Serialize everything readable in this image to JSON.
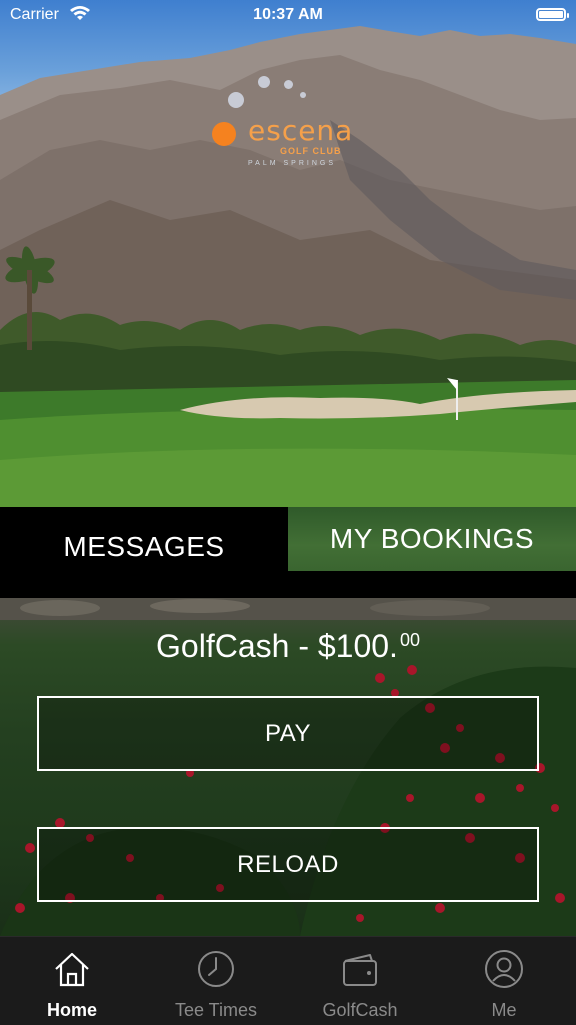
{
  "status_bar": {
    "carrier": "Carrier",
    "time": "10:37 AM"
  },
  "logo": {
    "brand": "escena",
    "sub": "GOLF CLUB",
    "tagline": "PALM SPRINGS"
  },
  "tabs": [
    {
      "label": "MESSAGES"
    },
    {
      "label": "MY BOOKINGS"
    }
  ],
  "golfcash": {
    "prefix": "GolfCash - $100.",
    "cents": "00"
  },
  "buttons": {
    "pay": "PAY",
    "reload": "RELOAD"
  },
  "nav": [
    {
      "label": "Home",
      "icon": "home-icon",
      "active": true
    },
    {
      "label": "Tee Times",
      "icon": "clock-icon",
      "active": false
    },
    {
      "label": "GolfCash",
      "icon": "wallet-icon",
      "active": false
    },
    {
      "label": "Me",
      "icon": "user-icon",
      "active": false
    }
  ],
  "colors": {
    "accent_orange": "#f5821f",
    "nav_bg": "#1b1b1b",
    "active_label": "#ffffff",
    "inactive_label": "#8a8a8a"
  }
}
